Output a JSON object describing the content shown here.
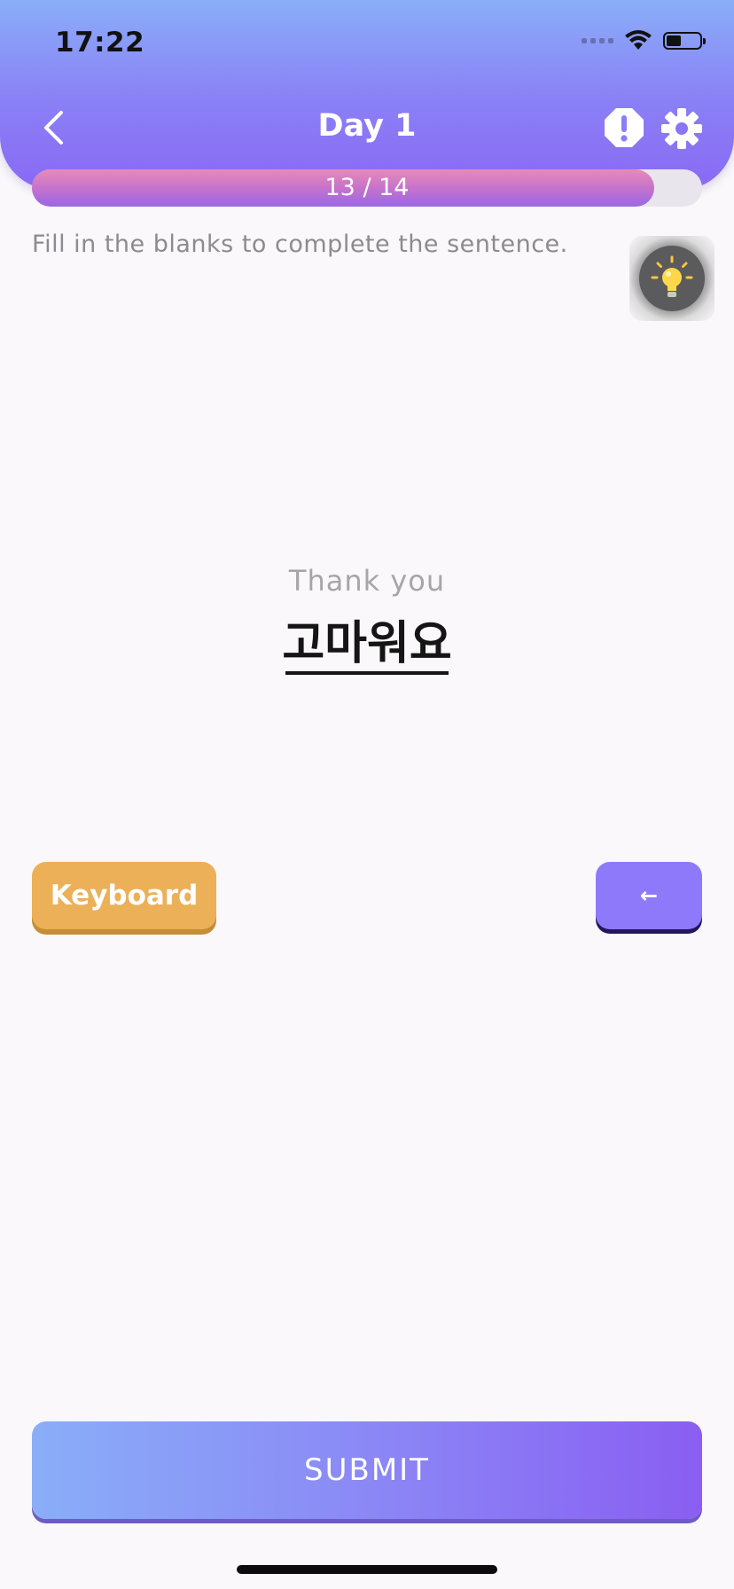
{
  "status_bar": {
    "time": "17:22",
    "battery_level": 0.45
  },
  "header": {
    "title": "Day 1",
    "back_icon": "chevron-left-icon",
    "report_icon": "alert-octagon-icon",
    "settings_icon": "gear-icon"
  },
  "progress": {
    "label": "13 / 14",
    "current": 13,
    "total": 14
  },
  "exercise": {
    "instruction": "Fill in the blanks to complete the sentence.",
    "hint_icon": "lightbulb-icon",
    "english": "Thank you",
    "korean": "고마워요"
  },
  "controls": {
    "keyboard_label": "Keyboard",
    "backspace_label": "←",
    "submit_label": "SUBMIT"
  },
  "colors": {
    "accent_purple": "#8f79fb",
    "keyboard_orange": "#ebb058",
    "header_gradient_top": "#8aaef8",
    "header_gradient_bottom": "#8a69f3"
  }
}
